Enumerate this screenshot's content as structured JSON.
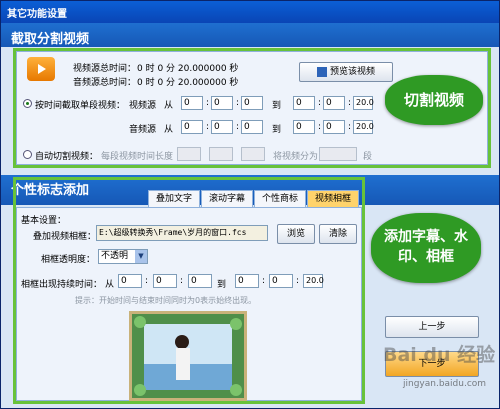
{
  "window": {
    "title": "其它功能设置"
  },
  "section1": {
    "heading": "截取分割视频",
    "video_total_label": "视频源总时间：",
    "video_total_value": "0  时  0  分 20.000000 秒",
    "audio_total_label": "音频源总时间：",
    "audio_total_value": "0  时  0  分 20.000000 秒",
    "preview_button": "预览该视频",
    "by_time_radio": "按时间截取单段视频：",
    "video_src_label": "视频源",
    "audio_src_label": "音频源",
    "from_label": "从",
    "to_label": "到",
    "time_inputs": {
      "video_from": [
        "0",
        "0",
        "0"
      ],
      "video_to": [
        "0",
        "0",
        "20.0"
      ],
      "audio_from": [
        "0",
        "0",
        "0"
      ],
      "audio_to": [
        "0",
        "0",
        "20.0"
      ]
    },
    "auto_radio": "自动切割视频：",
    "segment_length_label": "每段视频时间长度",
    "split_into_label": "将视频分为",
    "segment_unit": "段"
  },
  "section2": {
    "heading": "个性标志添加",
    "tabs": [
      "叠加文字",
      "滚动字幕",
      "个性商标",
      "视频相框"
    ],
    "active_tab": 3,
    "basic_settings": "基本设置：",
    "frame_label": "叠加视频相框：",
    "frame_path": "E:\\超级转换秀\\Frame\\岁月的窗口.fcs",
    "browse_button": "浏览",
    "clear_button": "清除",
    "opacity_label": "相框透明度：",
    "opacity_value": "不透明",
    "appear_time_label": "相框出现持续时间：",
    "from_label": "从",
    "to_label": "到",
    "appear_from": [
      "0",
      "0",
      "0"
    ],
    "appear_to": [
      "0",
      "0",
      "20.0"
    ],
    "hint": "提示：开始时间与结束时间同时为0表示始终出现。"
  },
  "buttons": {
    "prev": "上一步",
    "next": "下一步"
  },
  "annotations": {
    "bubble1": "切割视频",
    "bubble2": "添加字幕、水印、相框"
  },
  "watermark": {
    "brand": "Bai du 经验",
    "url": "jingyan.baidu.com"
  }
}
